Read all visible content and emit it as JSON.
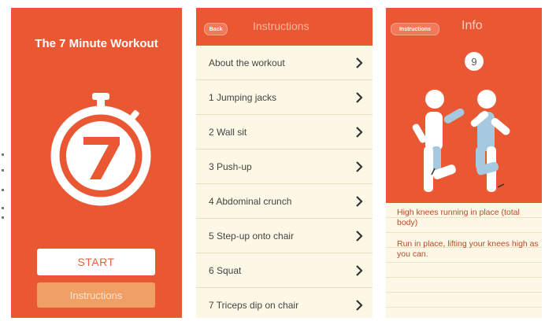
{
  "screen1": {
    "title": "The 7 Minute Workout",
    "logo_number": "7",
    "start_label": "START",
    "instructions_label": "Instructions"
  },
  "screen2": {
    "back_label": "Back",
    "title": "Instructions",
    "items": [
      {
        "label": "About the workout"
      },
      {
        "label": "1 Jumping jacks"
      },
      {
        "label": "2 Wall sit"
      },
      {
        "label": "3 Push-up"
      },
      {
        "label": "4 Abdominal crunch"
      },
      {
        "label": "5 Step-up onto chair"
      },
      {
        "label": "6 Squat"
      },
      {
        "label": "7 Triceps dip on chair"
      }
    ]
  },
  "screen3": {
    "back_label": "Instructions",
    "title": "Info",
    "step_number": "9",
    "exercise_name": "High knees running in place (total body)",
    "exercise_desc": "Run in place, lifting your knees high as you can."
  },
  "colors": {
    "accent": "#ea5733",
    "button_orange": "#f0a066",
    "list_background": "#fdf7e6",
    "figure_blue": "#a6c8e0",
    "text_orange": "#b84a28"
  }
}
